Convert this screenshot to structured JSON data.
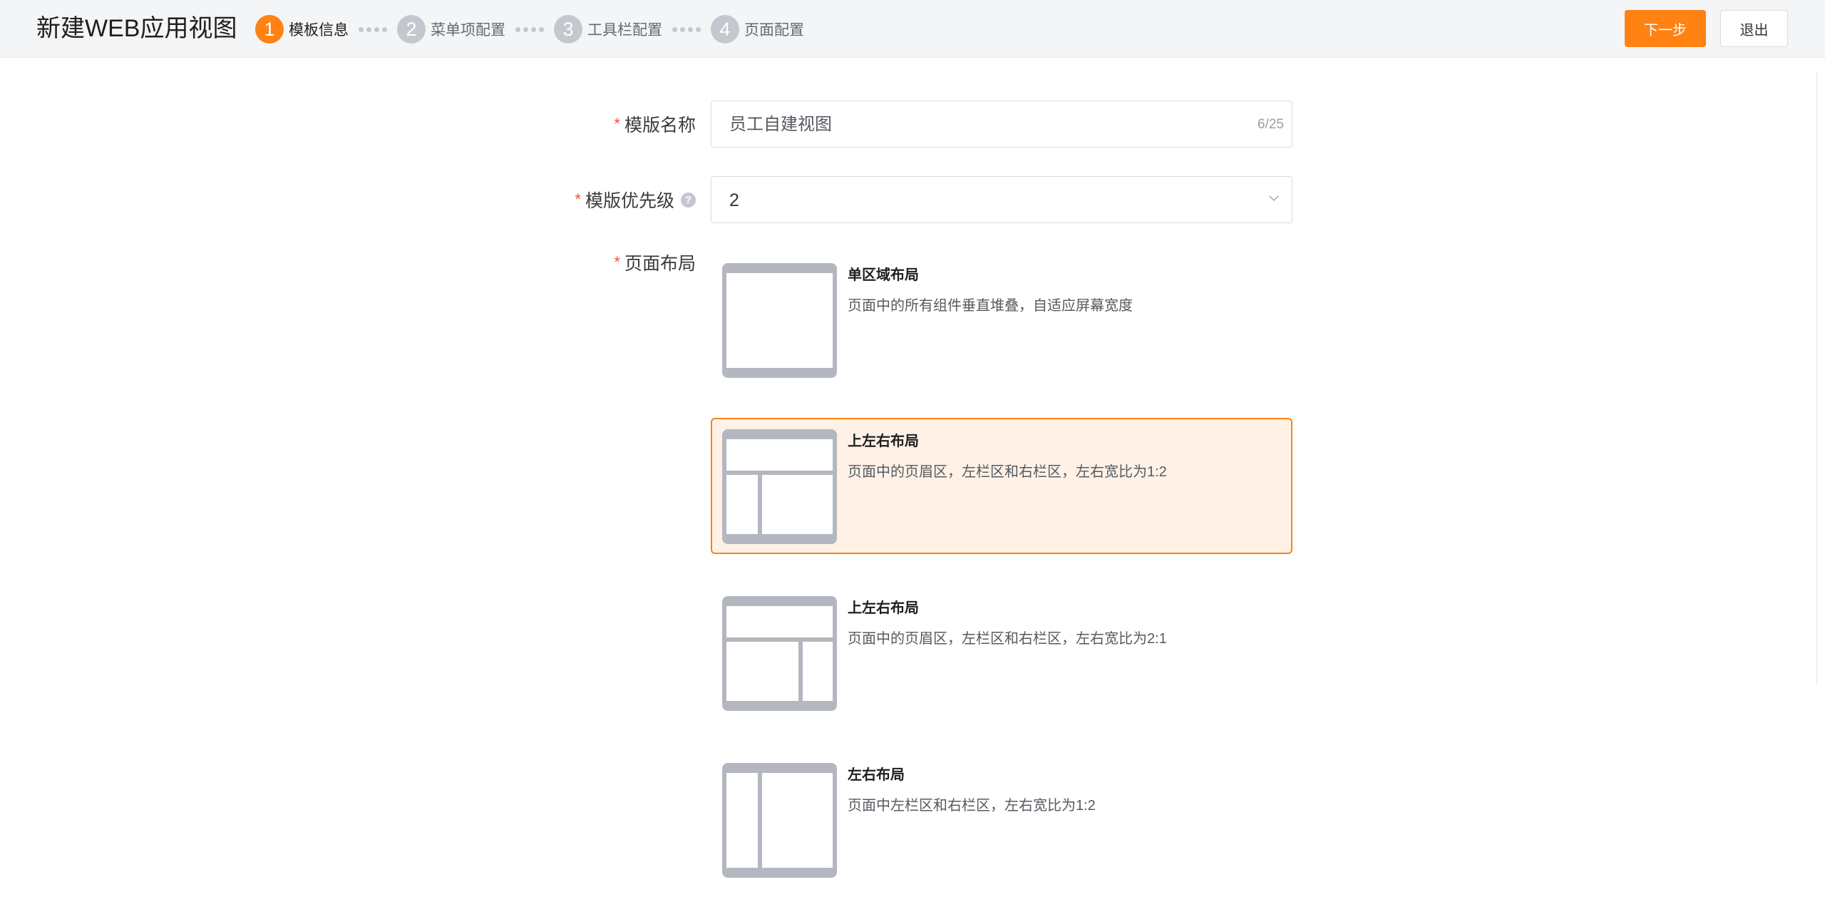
{
  "header": {
    "title": "新建WEB应用视图",
    "steps": [
      {
        "num": "1",
        "label": "模板信息",
        "active": true
      },
      {
        "num": "2",
        "label": "菜单项配置",
        "active": false
      },
      {
        "num": "3",
        "label": "工具栏配置",
        "active": false
      },
      {
        "num": "4",
        "label": "页面配置",
        "active": false
      }
    ],
    "next_label": "下一步",
    "exit_label": "退出"
  },
  "form": {
    "name": {
      "required_mark": "*",
      "label": "模版名称",
      "value": "员工自建视图",
      "counter": "6/25"
    },
    "priority": {
      "required_mark": "*",
      "label": "模版优先级",
      "help_icon": "?",
      "value": "2"
    },
    "layout": {
      "required_mark": "*",
      "label": "页面布局",
      "selected_index": 1,
      "options": [
        {
          "title": "单区域布局",
          "desc": "页面中的所有组件垂直堆叠，自适应屏幕宽度",
          "icon": "single-region-layout-icon"
        },
        {
          "title": "上左右布局",
          "desc": "页面中的页眉区，左栏区和右栏区，左右宽比为1:2",
          "icon": "top-left-right-1-2-layout-icon"
        },
        {
          "title": "上左右布局",
          "desc": "页面中的页眉区，左栏区和右栏区，左右宽比为2:1",
          "icon": "top-left-right-2-1-layout-icon"
        },
        {
          "title": "左右布局",
          "desc": "页面中左栏区和右栏区，左右宽比为1:2",
          "icon": "left-right-layout-icon"
        }
      ]
    }
  },
  "colors": {
    "accent": "#ff8212",
    "required": "#f5502f",
    "selected_bg": "#fff1e6",
    "thumb_gray": "#b4b7c0"
  }
}
